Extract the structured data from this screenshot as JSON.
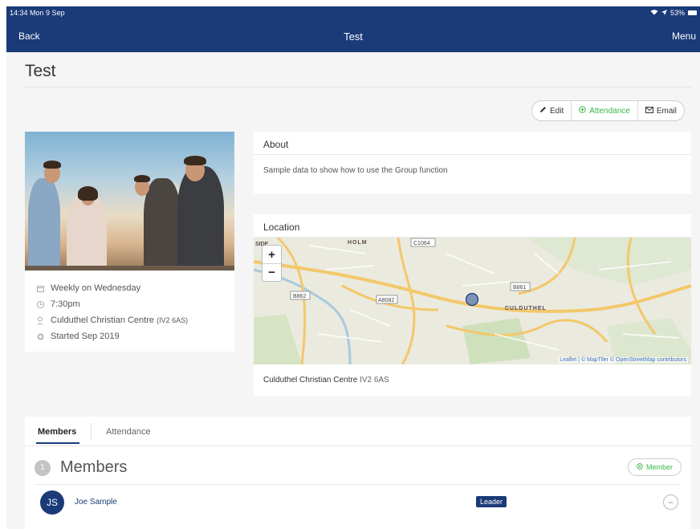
{
  "status_bar": {
    "time": "14:34",
    "date": "Mon 9 Sep",
    "battery": "53%"
  },
  "nav": {
    "back_label": "Back",
    "title": "Test",
    "menu_label": "Menu"
  },
  "page": {
    "title": "Test"
  },
  "actions": {
    "edit_label": "Edit",
    "attendance_label": "Attendance",
    "email_label": "Email"
  },
  "group": {
    "schedule": "Weekly on Wednesday",
    "time": "7:30pm",
    "venue": "Culduthel Christian Centre",
    "venue_postcode": "(IV2 6AS)",
    "started": "Started Sep 2019"
  },
  "about": {
    "heading": "About",
    "text": "Sample data to show how to use the Group function"
  },
  "location": {
    "heading": "Location",
    "map_labels": {
      "holm": "HOLM",
      "c1064": "C1064",
      "b861": "B861",
      "b862": "B862",
      "a8082": "A8082",
      "culduthel": "CULDUTHEL",
      "side": "SIDE"
    },
    "zoom_in": "+",
    "zoom_out": "−",
    "attribution": "Leaflet | © MapTiler © OpenStreetMap contributors",
    "venue": "Culduthel Christian Centre",
    "postcode": "IV2 6AS"
  },
  "tabs": {
    "members": "Members",
    "attendance": "Attendance"
  },
  "members": {
    "count": "1",
    "title": "Members",
    "add_label": "Member",
    "list": [
      {
        "initials": "JS",
        "name": "Joe Sample",
        "role": "Leader"
      }
    ]
  },
  "colors": {
    "nav_blue": "#1a3a78",
    "accent_green": "#3bb54a"
  }
}
